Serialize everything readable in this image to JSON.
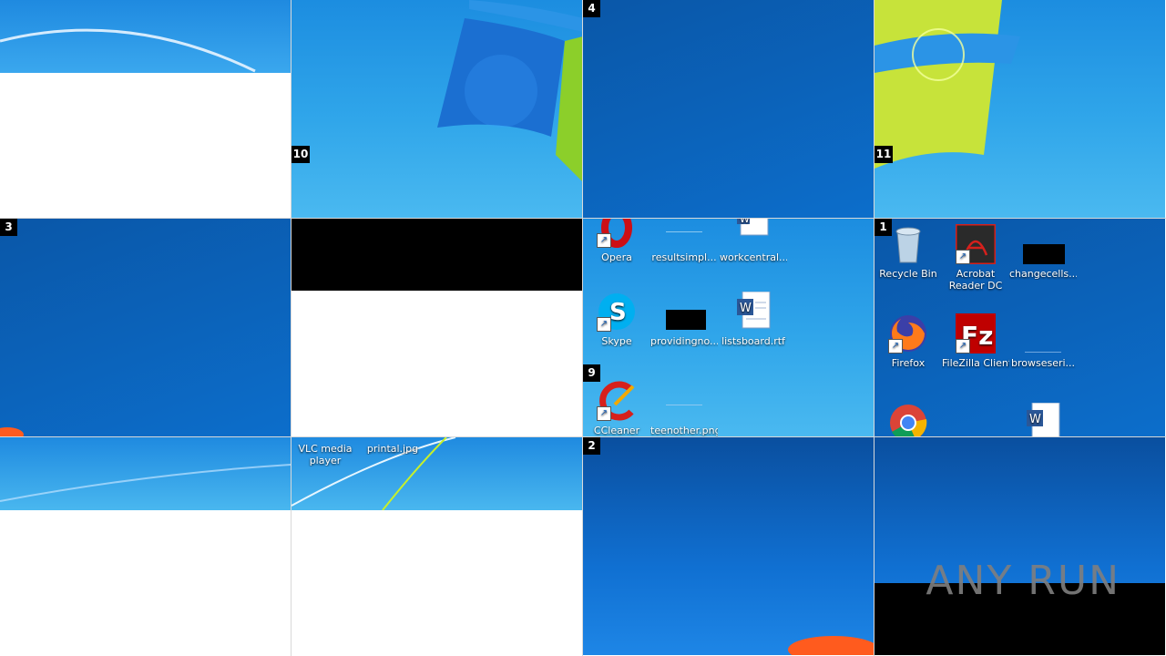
{
  "tiles": [
    {
      "id": "r1c1",
      "number": ""
    },
    {
      "id": "r1c2",
      "number": "10"
    },
    {
      "id": "r1c3",
      "number": "4"
    },
    {
      "id": "r1c4",
      "number": "11"
    },
    {
      "id": "r2c1",
      "number": "3"
    },
    {
      "id": "r2c2",
      "number": ""
    },
    {
      "id": "r2c3",
      "number": "9"
    },
    {
      "id": "r2c4",
      "number": "1"
    },
    {
      "id": "r3c1",
      "number": ""
    },
    {
      "id": "r3c2",
      "number": ""
    },
    {
      "id": "r3c3",
      "number": "2"
    },
    {
      "id": "r3c4",
      "number": ""
    }
  ],
  "desktop9": {
    "opera": "Opera",
    "resultsimpl": "resultsimpl...",
    "workcentral": "workcentral....",
    "skype": "Skype",
    "providingno": "providingno...",
    "listsboard": "listsboard.rtf",
    "ccleaner": "CCleaner",
    "teenother": "teenother.png"
  },
  "desktop1": {
    "recycle": "Recycle Bin",
    "acrobat": "Acrobat Reader DC",
    "changecells": "changecells...",
    "firefox": "Firefox",
    "filezilla": "FileZilla Client",
    "browseseri": "browseseri..."
  },
  "desktop_bottom": {
    "vlc": "VLC media player",
    "printal": "printal.jpg"
  },
  "watermark": "ANY RUN",
  "colors": {
    "opera_red": "#cc0f16",
    "skype_blue": "#00aff0",
    "firefox_orange": "#ff7a1a",
    "filezilla_red": "#bf0000",
    "acrobat_red": "#d6201c"
  }
}
